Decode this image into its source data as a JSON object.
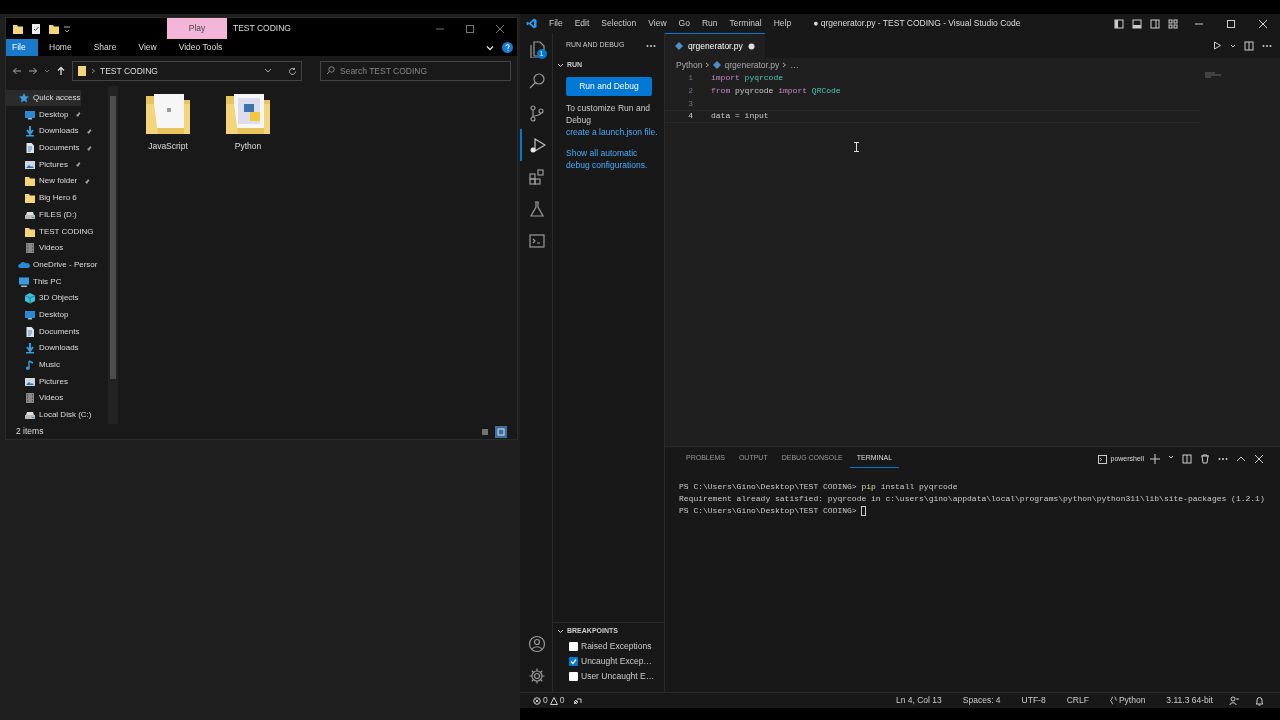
{
  "file_explorer": {
    "context_tab": "Play",
    "title": "TEST CODING",
    "ribbon_tabs": [
      {
        "label": "File",
        "selected": true
      },
      {
        "label": "Home",
        "selected": false
      },
      {
        "label": "Share",
        "selected": false
      },
      {
        "label": "View",
        "selected": false
      },
      {
        "label": "Video Tools",
        "selected": false
      }
    ],
    "address": "TEST CODING",
    "search": {
      "placeholder": "Search TEST CODING"
    },
    "navigation": [
      {
        "label": "Quick access",
        "kind": "star",
        "selected": true,
        "children": [
          {
            "label": "Desktop",
            "kind": "desktop",
            "pinned": true,
            "selected": false
          },
          {
            "label": "Downloads",
            "kind": "download",
            "pinned": true,
            "selected": false
          },
          {
            "label": "Documents",
            "kind": "document",
            "pinned": true,
            "selected": false
          },
          {
            "label": "Pictures",
            "kind": "picture",
            "pinned": true,
            "selected": false
          },
          {
            "label": "New folder",
            "kind": "folder",
            "pinned": true,
            "selected": false
          },
          {
            "label": "Big Hero 6",
            "kind": "folder",
            "pinned": false,
            "selected": false
          },
          {
            "label": "FILES (D:)",
            "kind": "drive",
            "pinned": false,
            "selected": false
          },
          {
            "label": "TEST CODING",
            "kind": "folder",
            "pinned": false,
            "selected": false
          },
          {
            "label": "Videos",
            "kind": "video",
            "pinned": false,
            "selected": false
          }
        ]
      },
      {
        "label": "OneDrive - Persor",
        "kind": "cloud",
        "selected": false
      },
      {
        "label": "This PC",
        "kind": "pc",
        "selected": false,
        "children": [
          {
            "label": "3D Objects",
            "kind": "cube",
            "pinned": false,
            "selected": false
          },
          {
            "label": "Desktop",
            "kind": "desktop",
            "pinned": false,
            "selected": false
          },
          {
            "label": "Documents",
            "kind": "document",
            "pinned": false,
            "selected": false
          },
          {
            "label": "Downloads",
            "kind": "download",
            "pinned": false,
            "selected": false
          },
          {
            "label": "Music",
            "kind": "music",
            "pinned": false,
            "selected": false
          },
          {
            "label": "Pictures",
            "kind": "picture",
            "pinned": false,
            "selected": false
          },
          {
            "label": "Videos",
            "kind": "video",
            "pinned": false,
            "selected": false
          },
          {
            "label": "Local Disk (C:)",
            "kind": "drive",
            "pinned": false,
            "selected": false
          }
        ]
      }
    ],
    "items": [
      {
        "name": "JavaScript",
        "kind": "plain"
      },
      {
        "name": "Python",
        "kind": "python"
      }
    ],
    "status": "2 items",
    "views": [
      {
        "kind": "details",
        "selected": false
      },
      {
        "kind": "large-icons",
        "selected": true
      }
    ]
  },
  "vscode": {
    "menu": [
      "File",
      "Edit",
      "Selection",
      "View",
      "Go",
      "Run",
      "Terminal",
      "Help"
    ],
    "title": "● qrgenerator.py - TEST CODING - Visual Studio Code",
    "activity": [
      {
        "kind": "explorer",
        "selected": false,
        "badge": "1"
      },
      {
        "kind": "search",
        "selected": false
      },
      {
        "kind": "source-control",
        "selected": false
      },
      {
        "kind": "run-debug",
        "selected": true
      },
      {
        "kind": "extensions",
        "selected": false
      },
      {
        "kind": "testing",
        "selected": false
      },
      {
        "kind": "remote-explorer",
        "selected": false
      }
    ],
    "activity_bottom": [
      {
        "kind": "account",
        "selected": false
      },
      {
        "kind": "settings",
        "selected": false
      }
    ],
    "sidebar": {
      "title": "RUN AND DEBUG",
      "section": "RUN",
      "button": "Run and Debug",
      "hint": "To customize Run and Debug",
      "hint_link": "create a launch.json file.",
      "link": "Show all automatic debug configurations.",
      "breakpoints": {
        "title": "BREAKPOINTS",
        "items": [
          {
            "label": "Raised Exceptions",
            "checked": false
          },
          {
            "label": "Uncaught Excep…",
            "checked": true
          },
          {
            "label": "User Uncaught E…",
            "checked": false
          }
        ]
      }
    },
    "editor": {
      "tabs": [
        {
          "label": "qrgenerator.py",
          "modified": true,
          "selected": true
        }
      ],
      "breadcrumb": [
        "Python",
        "qrgenerator.py",
        "…"
      ],
      "lines": [
        {
          "number": "1",
          "current": false,
          "tokens": [
            {
              "text": "import",
              "kind": "keyword"
            },
            {
              "text": " pyqrcode",
              "kind": "module"
            }
          ]
        },
        {
          "number": "2",
          "current": false,
          "tokens": [
            {
              "text": "from",
              "kind": "keyword"
            },
            {
              "text": " pyqrcode ",
              "kind": "plain"
            },
            {
              "text": "import",
              "kind": "keyword"
            },
            {
              "text": " QRCode",
              "kind": "module"
            }
          ]
        },
        {
          "number": "3",
          "current": false
        },
        {
          "number": "4",
          "current": true,
          "tokens": [
            {
              "text": "data = input",
              "kind": "plain"
            }
          ]
        }
      ]
    },
    "panel": {
      "tabs": [
        {
          "label": "PROBLEMS",
          "selected": false
        },
        {
          "label": "OUTPUT",
          "selected": false
        },
        {
          "label": "DEBUG CONSOLE",
          "selected": false
        },
        {
          "label": "TERMINAL",
          "selected": true
        }
      ],
      "shell": "powershell",
      "terminal": [
        {
          "parts": [
            {
              "text": "PS C:\\Users\\Gino\\Desktop\\TEST CODING> ",
              "kind": "plain"
            },
            {
              "text": "pip",
              "kind": "command"
            },
            {
              "text": " install pyqrcode",
              "kind": "plain"
            }
          ],
          "cursor": false
        },
        {
          "parts": [
            {
              "text": "Requirement already satisfied: pyqrcode in c:\\users\\gino\\appdata\\local\\programs\\python\\python311\\lib\\site-packages (1.2.1)",
              "kind": "plain"
            }
          ],
          "cursor": false
        },
        {
          "parts": [
            {
              "text": "PS C:\\Users\\Gino\\Desktop\\TEST CODING> ",
              "kind": "plain"
            }
          ],
          "cursor": true
        }
      ]
    },
    "status_bar": {
      "errors": "0",
      "warnings": "0",
      "items": [
        {
          "text": "Ln 4, Col 13",
          "kind": "text"
        },
        {
          "text": "Spaces: 4",
          "kind": "text"
        },
        {
          "text": "UTF-8",
          "kind": "text"
        },
        {
          "text": "CRLF",
          "kind": "text"
        },
        {
          "text": "Python",
          "kind": "language"
        },
        {
          "text": "3.11.3 64-bit",
          "kind": "text"
        }
      ]
    }
  }
}
